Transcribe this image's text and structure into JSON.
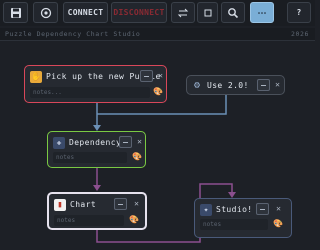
{
  "toolbar": {
    "save_icon": "floppy-disk-icon",
    "target_icon": "target-icon",
    "connect_label": "CONNECT",
    "disconnect_label": "DISCONNECT",
    "swap_icon": "swap-arrows-icon",
    "square_icon": "square-icon",
    "search_icon": "magnifier-icon",
    "layout_icon": "ellipsis-icon",
    "help_label": "?"
  },
  "header": {
    "title": "Puzzle Dependency Chart Studio",
    "year": "2026"
  },
  "nodes": [
    {
      "label": "Pick up the new Puzzle",
      "icon": "✋",
      "icon_name": "hand-icon",
      "placeholder": "notes...",
      "color": "#d9475a"
    },
    {
      "label": "Use 2.0!",
      "icon": "⚙",
      "icon_name": "gear-icon",
      "placeholder": "notes...",
      "color": "#4a505a"
    },
    {
      "label": "Dependency",
      "icon": "✚",
      "icon_name": "move-cross-icon",
      "placeholder": "notes",
      "color": "#7ac943"
    },
    {
      "label": "Chart",
      "icon": "▮",
      "icon_name": "bar-chart-icon",
      "placeholder": "notes",
      "color": "#e6e2ee"
    },
    {
      "label": "Studio!",
      "icon": "✦",
      "icon_name": "sparkle-icon",
      "placeholder": "notes",
      "color": "#4a5a7a"
    }
  ],
  "colors": {
    "background": "#1d2026",
    "wire_blue": "#6b8fb5",
    "wire_purple": "#8b4f8f",
    "accent": "#7aaed6"
  }
}
